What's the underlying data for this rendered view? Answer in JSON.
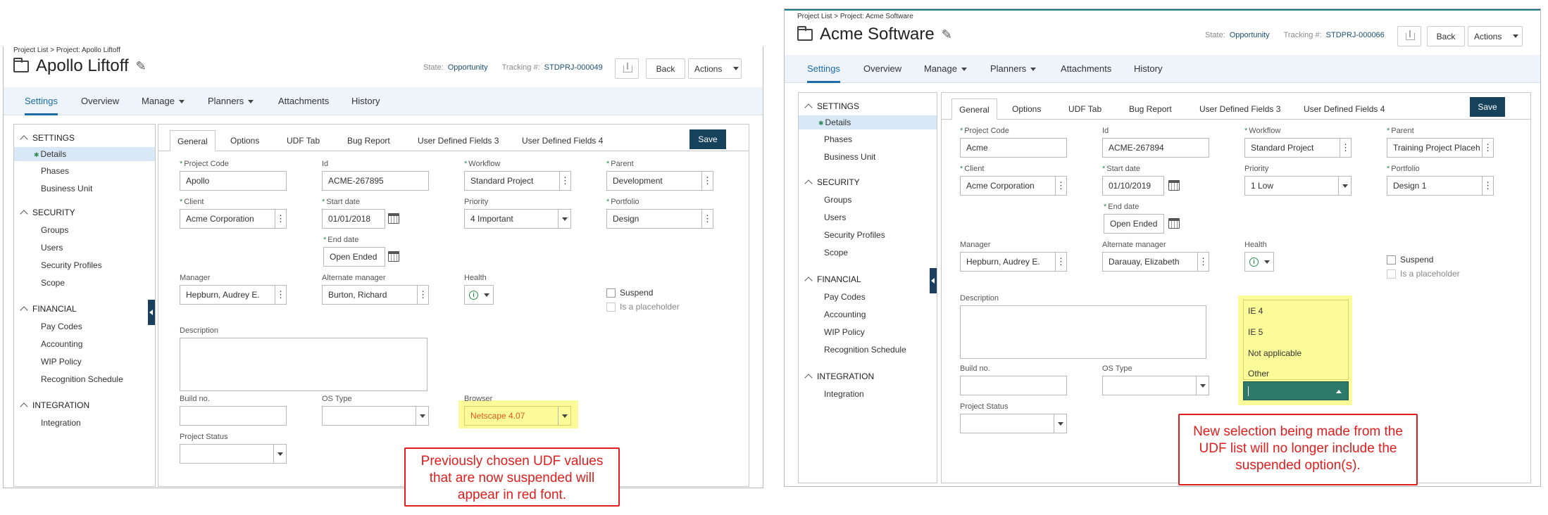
{
  "left": {
    "breadcrumb": "Project List > Project: Apollo Liftoff",
    "title": "Apollo Liftoff",
    "state_label": "State:",
    "state_value": "Opportunity",
    "tracking_label": "Tracking #:",
    "tracking_value": "STDPRJ-000049",
    "back_label": "Back",
    "actions_label": "Actions",
    "nav_tabs": [
      "Settings",
      "Overview",
      "Manage",
      "Planners",
      "Attachments",
      "History"
    ],
    "sidebar": {
      "settings_header": "SETTINGS",
      "settings_items": [
        "Details",
        "Phases",
        "Business Unit"
      ],
      "security_header": "SECURITY",
      "security_items": [
        "Groups",
        "Users",
        "Security Profiles",
        "Scope"
      ],
      "financial_header": "FINANCIAL",
      "financial_items": [
        "Pay Codes",
        "Accounting",
        "WIP Policy",
        "Recognition Schedule"
      ],
      "integration_header": "INTEGRATION",
      "integration_items": [
        "Integration"
      ]
    },
    "inner_tabs": [
      "General",
      "Options",
      "UDF Tab",
      "Bug Report",
      "User Defined Fields 3",
      "User Defined Fields 4"
    ],
    "save_label": "Save",
    "fields": {
      "project_code_label": "Project Code",
      "project_code": "Apollo",
      "id_label": "Id",
      "id": "ACME-267895",
      "workflow_label": "Workflow",
      "workflow": "Standard Project",
      "parent_label": "Parent",
      "parent": "Development",
      "client_label": "Client",
      "client": "Acme Corporation",
      "start_label": "Start date",
      "start": "01/01/2018",
      "priority_label": "Priority",
      "priority": "4 Important",
      "portfolio_label": "Portfolio",
      "portfolio": "Design",
      "end_label": "End date",
      "end": "Open Ended",
      "manager_label": "Manager",
      "manager": "Hepburn, Audrey E.",
      "alt_manager_label": "Alternate manager",
      "alt_manager": "Burton, Richard",
      "health_label": "Health",
      "suspend_label": "Suspend",
      "placeholder_label": "Is a placeholder",
      "description_label": "Description",
      "build_label": "Build no.",
      "os_label": "OS Type",
      "browser_label": "Browser",
      "browser": "Netscape 4.07",
      "status_label": "Project Status"
    },
    "note": "Previously chosen UDF values that are now suspended will appear in red font.",
    "colors": {
      "suspended_text": "#e05a1a",
      "highlight": "#fbfb9a",
      "note_border": "#e01e1e"
    }
  },
  "right": {
    "breadcrumb": "Project List > Project: Acme Software",
    "title": "Acme Software",
    "state_label": "State:",
    "state_value": "Opportunity",
    "tracking_label": "Tracking #:",
    "tracking_value": "STDPRJ-000066",
    "back_label": "Back",
    "actions_label": "Actions",
    "nav_tabs": [
      "Settings",
      "Overview",
      "Manage",
      "Planners",
      "Attachments",
      "History"
    ],
    "sidebar": {
      "settings_header": "SETTINGS",
      "settings_items": [
        "Details",
        "Phases",
        "Business Unit"
      ],
      "security_header": "SECURITY",
      "security_items": [
        "Groups",
        "Users",
        "Security Profiles",
        "Scope"
      ],
      "financial_header": "FINANCIAL",
      "financial_items": [
        "Pay Codes",
        "Accounting",
        "WIP Policy",
        "Recognition Schedule"
      ],
      "integration_header": "INTEGRATION",
      "integration_items": [
        "Integration"
      ]
    },
    "inner_tabs": [
      "General",
      "Options",
      "UDF Tab",
      "Bug Report",
      "User Defined Fields 3",
      "User Defined Fields 4"
    ],
    "save_label": "Save",
    "fields": {
      "project_code_label": "Project Code",
      "project_code": "Acme",
      "id_label": "Id",
      "id": "ACME-267894",
      "workflow_label": "Workflow",
      "workflow": "Standard Project",
      "parent_label": "Parent",
      "parent": "Training Project Placeh",
      "client_label": "Client",
      "client": "Acme Corporation",
      "start_label": "Start date",
      "start": "01/10/2019",
      "priority_label": "Priority",
      "priority": "1 Low",
      "portfolio_label": "Portfolio",
      "portfolio": "Design 1",
      "end_label": "End date",
      "end": "Open Ended",
      "manager_label": "Manager",
      "manager": "Hepburn, Audrey E.",
      "alt_manager_label": "Alternate manager",
      "alt_manager": "Darauay, Elizabeth",
      "health_label": "Health",
      "suspend_label": "Suspend",
      "placeholder_label": "Is a placeholder",
      "description_label": "Description",
      "build_label": "Build no.",
      "os_label": "OS Type",
      "status_label": "Project Status"
    },
    "dropdown_options": [
      "IE 4",
      "IE 5",
      "Not applicable",
      "Other"
    ],
    "note": "New selection being made from the UDF list will no longer include the suspended option(s).",
    "colors": {
      "highlight": "#fbfb9a",
      "selected_bg": "#2d7a6a"
    }
  }
}
